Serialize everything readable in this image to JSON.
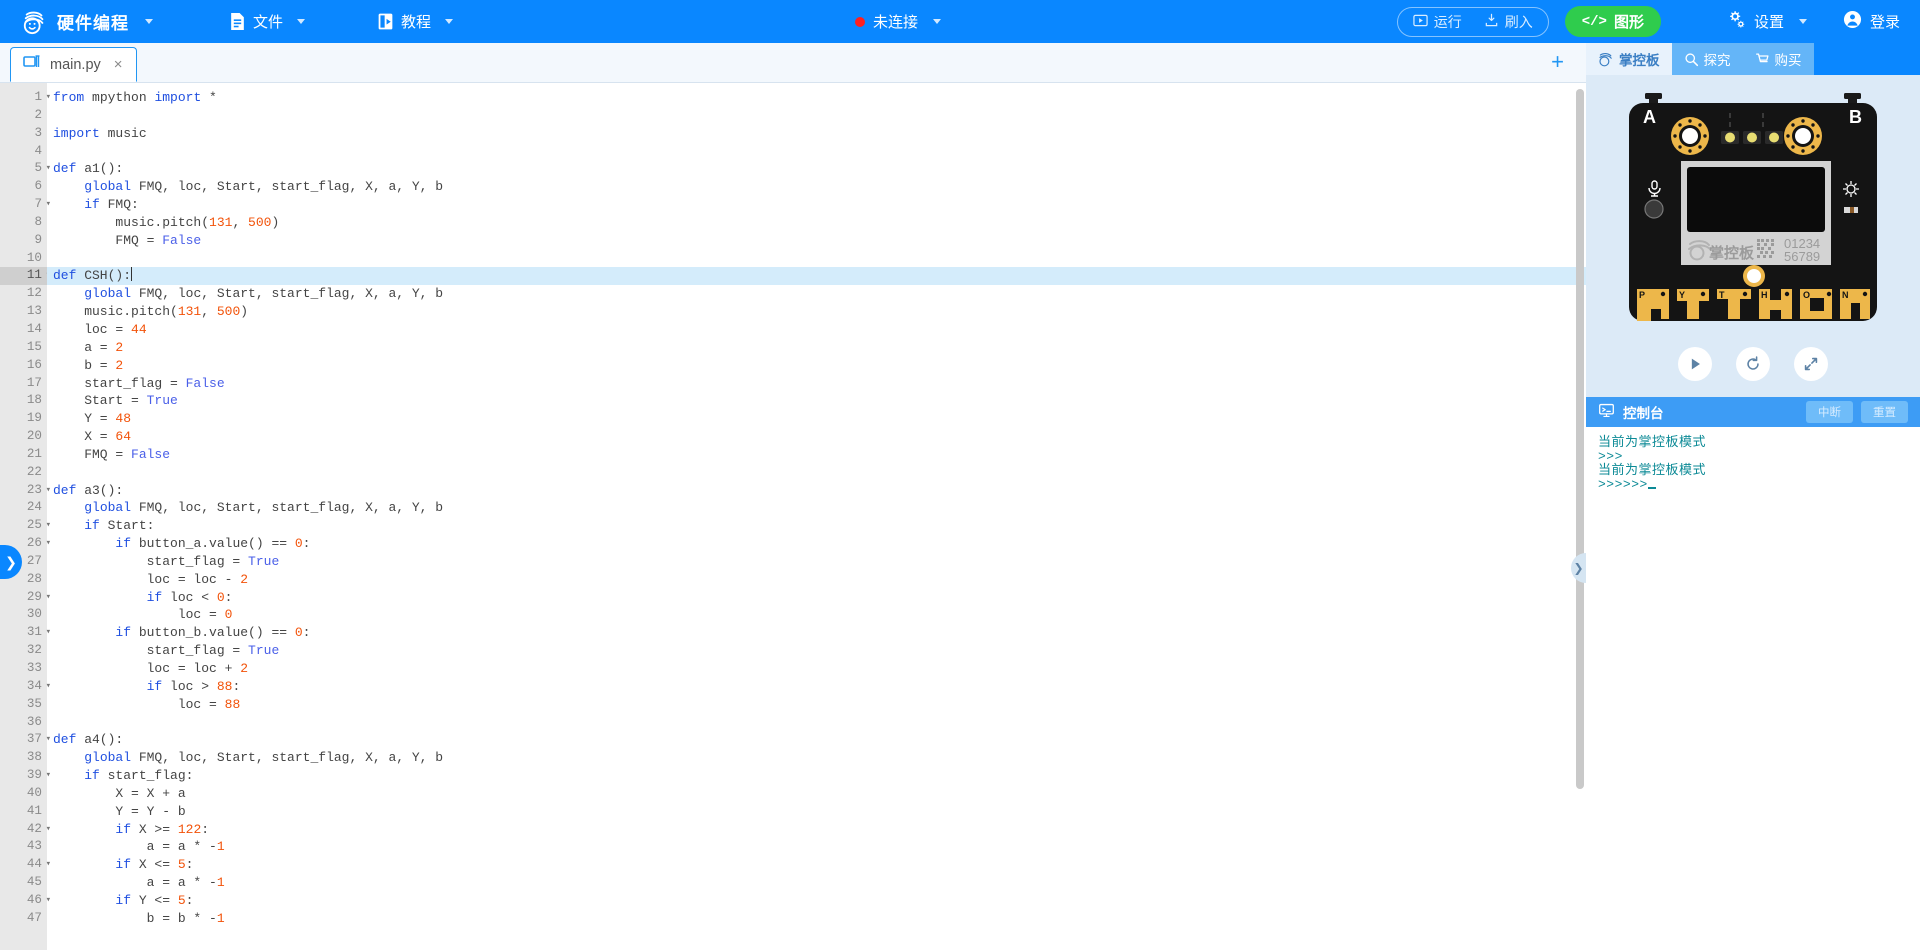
{
  "topbar": {
    "brand": "硬件编程",
    "brand_icon": "mpython-logo-icon",
    "menus": [
      {
        "label": "文件",
        "icon": "file-icon"
      },
      {
        "label": "教程",
        "icon": "book-icon"
      }
    ],
    "connection": {
      "label": "未连接",
      "status_color": "#ff1f1f",
      "icon": "status-dot-icon"
    },
    "run": {
      "label": "运行",
      "icon": "play-box-icon"
    },
    "flash": {
      "label": "刷入",
      "icon": "download-icon"
    },
    "mode": {
      "label": "图形",
      "icon": "code-icon",
      "color": "#2fcc4d"
    },
    "settings": {
      "label": "设置",
      "icon": "gears-icon"
    },
    "login": {
      "label": "登录",
      "icon": "user-circle-icon"
    },
    "bg_color": "#0a87ff"
  },
  "tabbar": {
    "tabs": [
      {
        "label": "main.py",
        "icon": "file-window-icon",
        "close": "×",
        "active": true
      }
    ],
    "add_label": "+"
  },
  "editor": {
    "highlight_line": 11,
    "cursor_line": 11,
    "lines": [
      {
        "n": 1,
        "fold": true,
        "text": "from mpython import *",
        "tokens": [
          [
            "kw",
            "from"
          ],
          [
            "pl",
            " mpython "
          ],
          [
            "kw",
            "import"
          ],
          [
            "pl",
            " *"
          ]
        ]
      },
      {
        "n": 2,
        "fold": false,
        "text": ""
      },
      {
        "n": 3,
        "fold": false,
        "text": "import music",
        "tokens": [
          [
            "kw",
            "import"
          ],
          [
            "pl",
            " music"
          ]
        ]
      },
      {
        "n": 4,
        "fold": false,
        "text": ""
      },
      {
        "n": 5,
        "fold": true,
        "text": "def a1():",
        "tokens": [
          [
            "kw",
            "def"
          ],
          [
            "pl",
            " a1():"
          ]
        ]
      },
      {
        "n": 6,
        "fold": false,
        "text": "    global FMQ, loc, Start, start_flag, X, a, Y, b",
        "tokens": [
          [
            "pl",
            "    "
          ],
          [
            "kw",
            "global"
          ],
          [
            "pl",
            " FMQ, loc, Start, start_flag, X, a, Y, b"
          ]
        ]
      },
      {
        "n": 7,
        "fold": true,
        "text": "    if FMQ:",
        "tokens": [
          [
            "pl",
            "    "
          ],
          [
            "kw",
            "if"
          ],
          [
            "pl",
            " FMQ:"
          ]
        ]
      },
      {
        "n": 8,
        "fold": false,
        "text": "        music.pitch(131, 500)",
        "tokens": [
          [
            "pl",
            "        music.pitch("
          ],
          [
            "num",
            "131"
          ],
          [
            "pl",
            ", "
          ],
          [
            "num",
            "500"
          ],
          [
            "pl",
            ")"
          ]
        ]
      },
      {
        "n": 9,
        "fold": false,
        "text": "        FMQ = False",
        "tokens": [
          [
            "pl",
            "        FMQ = "
          ],
          [
            "bool",
            "False"
          ]
        ]
      },
      {
        "n": 10,
        "fold": false,
        "text": ""
      },
      {
        "n": 11,
        "fold": true,
        "text": "def CSH():",
        "tokens": [
          [
            "kw",
            "def"
          ],
          [
            "pl",
            " CSH():"
          ]
        ],
        "cursor": true
      },
      {
        "n": 12,
        "fold": false,
        "text": "    global FMQ, loc, Start, start_flag, X, a, Y, b",
        "tokens": [
          [
            "pl",
            "    "
          ],
          [
            "kw",
            "global"
          ],
          [
            "pl",
            " FMQ, loc, Start, start_flag, X, a, Y, b"
          ]
        ]
      },
      {
        "n": 13,
        "fold": false,
        "text": "    music.pitch(131, 500)",
        "tokens": [
          [
            "pl",
            "    music.pitch("
          ],
          [
            "num",
            "131"
          ],
          [
            "pl",
            ", "
          ],
          [
            "num",
            "500"
          ],
          [
            "pl",
            ")"
          ]
        ]
      },
      {
        "n": 14,
        "fold": false,
        "text": "    loc = 44",
        "tokens": [
          [
            "pl",
            "    loc = "
          ],
          [
            "num",
            "44"
          ]
        ]
      },
      {
        "n": 15,
        "fold": false,
        "text": "    a = 2",
        "tokens": [
          [
            "pl",
            "    a = "
          ],
          [
            "num",
            "2"
          ]
        ]
      },
      {
        "n": 16,
        "fold": false,
        "text": "    b = 2",
        "tokens": [
          [
            "pl",
            "    b = "
          ],
          [
            "num",
            "2"
          ]
        ]
      },
      {
        "n": 17,
        "fold": false,
        "text": "    start_flag = False",
        "tokens": [
          [
            "pl",
            "    start_flag = "
          ],
          [
            "bool",
            "False"
          ]
        ]
      },
      {
        "n": 18,
        "fold": false,
        "text": "    Start = True",
        "tokens": [
          [
            "pl",
            "    Start = "
          ],
          [
            "bool",
            "True"
          ]
        ]
      },
      {
        "n": 19,
        "fold": false,
        "text": "    Y = 48",
        "tokens": [
          [
            "pl",
            "    Y = "
          ],
          [
            "num",
            "48"
          ]
        ]
      },
      {
        "n": 20,
        "fold": false,
        "text": "    X = 64",
        "tokens": [
          [
            "pl",
            "    X = "
          ],
          [
            "num",
            "64"
          ]
        ]
      },
      {
        "n": 21,
        "fold": false,
        "text": "    FMQ = False",
        "tokens": [
          [
            "pl",
            "    FMQ = "
          ],
          [
            "bool",
            "False"
          ]
        ]
      },
      {
        "n": 22,
        "fold": false,
        "text": ""
      },
      {
        "n": 23,
        "fold": true,
        "text": "def a3():",
        "tokens": [
          [
            "kw",
            "def"
          ],
          [
            "pl",
            " a3():"
          ]
        ]
      },
      {
        "n": 24,
        "fold": false,
        "text": "    global FMQ, loc, Start, start_flag, X, a, Y, b",
        "tokens": [
          [
            "pl",
            "    "
          ],
          [
            "kw",
            "global"
          ],
          [
            "pl",
            " FMQ, loc, Start, start_flag, X, a, Y, b"
          ]
        ]
      },
      {
        "n": 25,
        "fold": true,
        "text": "    if Start:",
        "tokens": [
          [
            "pl",
            "    "
          ],
          [
            "kw",
            "if"
          ],
          [
            "pl",
            " Start:"
          ]
        ]
      },
      {
        "n": 26,
        "fold": true,
        "text": "        if button_a.value() == 0:",
        "tokens": [
          [
            "pl",
            "        "
          ],
          [
            "kw",
            "if"
          ],
          [
            "pl",
            " button_a.value() == "
          ],
          [
            "num",
            "0"
          ],
          [
            "pl",
            ":"
          ]
        ]
      },
      {
        "n": 27,
        "fold": false,
        "text": "            start_flag = True",
        "tokens": [
          [
            "pl",
            "            start_flag = "
          ],
          [
            "bool",
            "True"
          ]
        ]
      },
      {
        "n": 28,
        "fold": false,
        "text": "            loc = loc - 2",
        "tokens": [
          [
            "pl",
            "            loc = loc - "
          ],
          [
            "num",
            "2"
          ]
        ]
      },
      {
        "n": 29,
        "fold": true,
        "text": "            if loc < 0:",
        "tokens": [
          [
            "pl",
            "            "
          ],
          [
            "kw",
            "if"
          ],
          [
            "pl",
            " loc < "
          ],
          [
            "num",
            "0"
          ],
          [
            "pl",
            ":"
          ]
        ]
      },
      {
        "n": 30,
        "fold": false,
        "text": "                loc = 0",
        "tokens": [
          [
            "pl",
            "                loc = "
          ],
          [
            "num",
            "0"
          ]
        ]
      },
      {
        "n": 31,
        "fold": true,
        "text": "        if button_b.value() == 0:",
        "tokens": [
          [
            "pl",
            "        "
          ],
          [
            "kw",
            "if"
          ],
          [
            "pl",
            " button_b.value() == "
          ],
          [
            "num",
            "0"
          ],
          [
            "pl",
            ":"
          ]
        ]
      },
      {
        "n": 32,
        "fold": false,
        "text": "            start_flag = True",
        "tokens": [
          [
            "pl",
            "            start_flag = "
          ],
          [
            "bool",
            "True"
          ]
        ]
      },
      {
        "n": 33,
        "fold": false,
        "text": "            loc = loc + 2",
        "tokens": [
          [
            "pl",
            "            loc = loc + "
          ],
          [
            "num",
            "2"
          ]
        ]
      },
      {
        "n": 34,
        "fold": true,
        "text": "            if loc > 88:",
        "tokens": [
          [
            "pl",
            "            "
          ],
          [
            "kw",
            "if"
          ],
          [
            "pl",
            " loc > "
          ],
          [
            "num",
            "88"
          ],
          [
            "pl",
            ":"
          ]
        ]
      },
      {
        "n": 35,
        "fold": false,
        "text": "                loc = 88",
        "tokens": [
          [
            "pl",
            "                loc = "
          ],
          [
            "num",
            "88"
          ]
        ]
      },
      {
        "n": 36,
        "fold": false,
        "text": ""
      },
      {
        "n": 37,
        "fold": true,
        "text": "def a4():",
        "tokens": [
          [
            "kw",
            "def"
          ],
          [
            "pl",
            " a4():"
          ]
        ]
      },
      {
        "n": 38,
        "fold": false,
        "text": "    global FMQ, loc, Start, start_flag, X, a, Y, b",
        "tokens": [
          [
            "pl",
            "    "
          ],
          [
            "kw",
            "global"
          ],
          [
            "pl",
            " FMQ, loc, Start, start_flag, X, a, Y, b"
          ]
        ]
      },
      {
        "n": 39,
        "fold": true,
        "text": "    if start_flag:",
        "tokens": [
          [
            "pl",
            "    "
          ],
          [
            "kw",
            "if"
          ],
          [
            "pl",
            " start_flag:"
          ]
        ]
      },
      {
        "n": 40,
        "fold": false,
        "text": "        X = X + a",
        "tokens": [
          [
            "pl",
            "        X = X + a"
          ]
        ]
      },
      {
        "n": 41,
        "fold": false,
        "text": "        Y = Y - b",
        "tokens": [
          [
            "pl",
            "        Y = Y - b"
          ]
        ]
      },
      {
        "n": 42,
        "fold": true,
        "text": "        if X >= 122:",
        "tokens": [
          [
            "pl",
            "        "
          ],
          [
            "kw",
            "if"
          ],
          [
            "pl",
            " X >= "
          ],
          [
            "num",
            "122"
          ],
          [
            "pl",
            ":"
          ]
        ]
      },
      {
        "n": 43,
        "fold": false,
        "text": "            a = a * -1",
        "tokens": [
          [
            "pl",
            "            a = a * -"
          ],
          [
            "num",
            "1"
          ]
        ]
      },
      {
        "n": 44,
        "fold": true,
        "text": "        if X <= 5:",
        "tokens": [
          [
            "pl",
            "        "
          ],
          [
            "kw",
            "if"
          ],
          [
            "pl",
            " X <= "
          ],
          [
            "num",
            "5"
          ],
          [
            "pl",
            ":"
          ]
        ]
      },
      {
        "n": 45,
        "fold": false,
        "text": "            a = a * -1",
        "tokens": [
          [
            "pl",
            "            a = a * -"
          ],
          [
            "num",
            "1"
          ]
        ]
      },
      {
        "n": 46,
        "fold": true,
        "text": "        if Y <= 5:",
        "tokens": [
          [
            "pl",
            "        "
          ],
          [
            "kw",
            "if"
          ],
          [
            "pl",
            " Y <= "
          ],
          [
            "num",
            "5"
          ],
          [
            "pl",
            ":"
          ]
        ]
      },
      {
        "n": 47,
        "fold": false,
        "text": "            b = b * -1",
        "tokens": [
          [
            "pl",
            "            b = b * -"
          ],
          [
            "num",
            "1"
          ]
        ]
      }
    ]
  },
  "left_handle": {
    "icon": "chevron-right-icon",
    "glyph": "❯"
  },
  "right_handle": {
    "icon": "chevron-right-icon",
    "glyph": "❯"
  },
  "right_panel": {
    "tabs": [
      {
        "label": "掌控板",
        "icon": "board-logo-icon",
        "active": true
      },
      {
        "label": "探究",
        "icon": "search-icon",
        "active": false
      },
      {
        "label": "购买",
        "icon": "cart-icon",
        "active": false
      }
    ],
    "board": {
      "button_a": "A",
      "button_b": "B",
      "brand": "掌控板",
      "serial_line1": "01234",
      "serial_line2": "56789",
      "letters": [
        "P",
        "Y",
        "T",
        "H",
        "O",
        "N"
      ],
      "mic_icon": "microphone-icon",
      "light_icon": "light-sensor-icon",
      "body_color": "#141414",
      "gold_color": "#edb74a"
    },
    "controls": [
      {
        "name": "play-button",
        "icon": "play-icon",
        "glyph": "▶"
      },
      {
        "name": "reset-button",
        "icon": "refresh-icon",
        "glyph": "↺"
      },
      {
        "name": "fullscreen-button",
        "icon": "expand-icon",
        "glyph": "⤢"
      }
    ],
    "console": {
      "title": "控制台",
      "icon": "terminal-icon",
      "interrupt_label": "中断",
      "reset_label": "重置",
      "lines": [
        "当前为掌控板模式",
        ">>>",
        "当前为掌控板模式",
        ">>>>>>"
      ]
    }
  }
}
